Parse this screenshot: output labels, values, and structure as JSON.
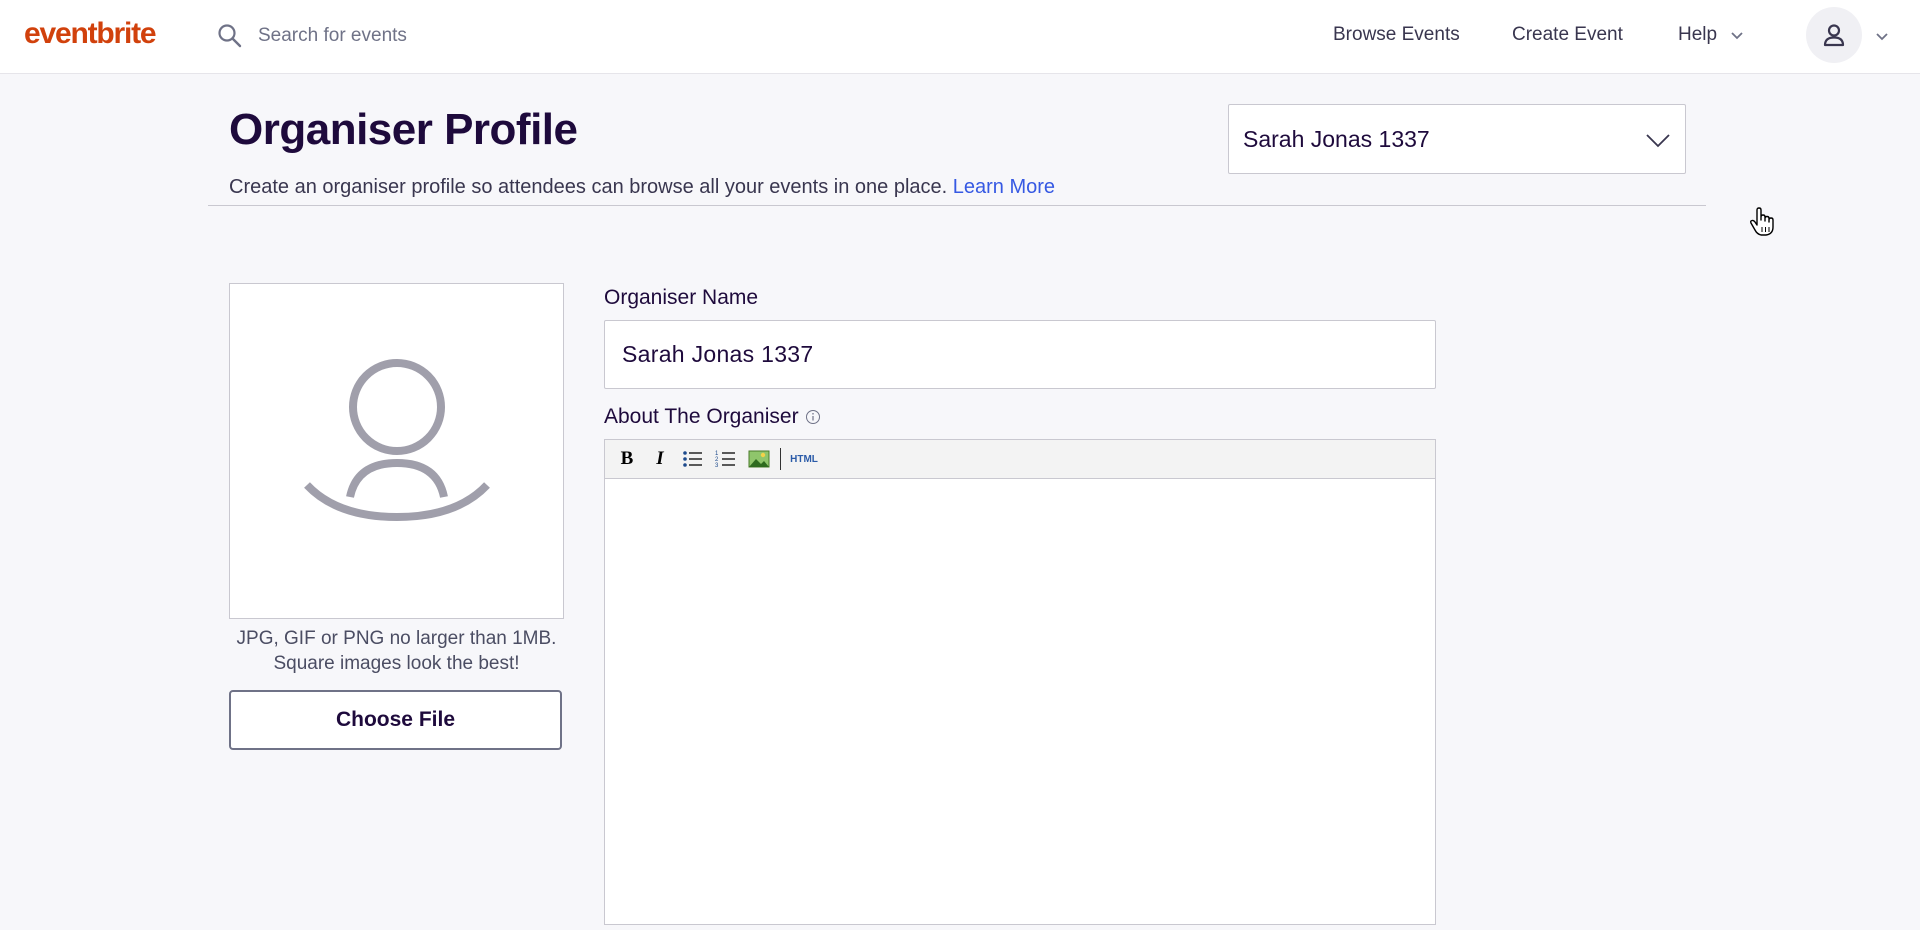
{
  "header": {
    "logo": "eventbrite",
    "search_placeholder": "Search for events",
    "nav": {
      "browse": "Browse Events",
      "create": "Create Event",
      "help": "Help"
    }
  },
  "page": {
    "title": "Organiser Profile",
    "description": "Create an organiser profile so attendees can browse all your events in one place.",
    "learn_more": "Learn More",
    "organiser_select": "Sarah Jonas 1337"
  },
  "image": {
    "hint_line1": "JPG, GIF or PNG no larger than 1MB.",
    "hint_line2": "Square images look the best!",
    "choose_file": "Choose File"
  },
  "form": {
    "name_label": "Organiser Name",
    "name_value": "Sarah Jonas 1337",
    "about_label": "About The Organiser",
    "toolbar": {
      "bold": "B",
      "italic": "I",
      "html": "HTML"
    }
  },
  "colors": {
    "brand": "#d1410c",
    "link": "#3659e3",
    "text_dark": "#1e0a3c",
    "background": "#f7f7fa"
  }
}
